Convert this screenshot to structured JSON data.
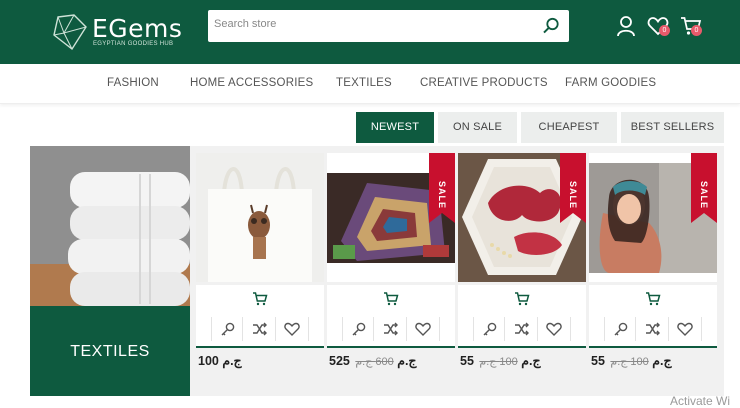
{
  "header": {
    "logo_title": "EGems",
    "logo_subtitle": "EGYPTIAN GOODIES HUB",
    "search_placeholder": "Search store",
    "wishlist_count": "0",
    "cart_count": "0"
  },
  "nav": {
    "items": [
      {
        "label": "FASHION"
      },
      {
        "label": "HOME ACCESSORIES"
      },
      {
        "label": "TEXTILES"
      },
      {
        "label": "CREATIVE PRODUCTS"
      },
      {
        "label": "FARM GOODIES"
      }
    ]
  },
  "filters": [
    {
      "label": "NEWEST",
      "active": true
    },
    {
      "label": "ON SALE",
      "active": false
    },
    {
      "label": "CHEAPEST",
      "active": false
    },
    {
      "label": "BEST SELLERS",
      "active": false
    }
  ],
  "category": {
    "label": "TEXTILES"
  },
  "products": [
    {
      "price": "100 ج.م",
      "old_price": "",
      "sale": false
    },
    {
      "price": "525 ج.م",
      "old_price": "600 ج.م",
      "sale": true,
      "sale_label": "SALE"
    },
    {
      "price": "55 ج.م",
      "old_price": "100 ج.م",
      "sale": true,
      "sale_label": "SALE"
    },
    {
      "price": "55 ج.م",
      "old_price": "100 ج.م",
      "sale": true,
      "sale_label": "SALE"
    }
  ],
  "os_watermark": "Activate Wi",
  "colors": {
    "brand_green": "#0e5a3f",
    "sale_red": "#c8102e",
    "badge_pink": "#e85a6b"
  },
  "icons": [
    "search-icon",
    "user-icon",
    "heart-icon",
    "cart-icon",
    "key-icon",
    "shuffle-icon"
  ]
}
